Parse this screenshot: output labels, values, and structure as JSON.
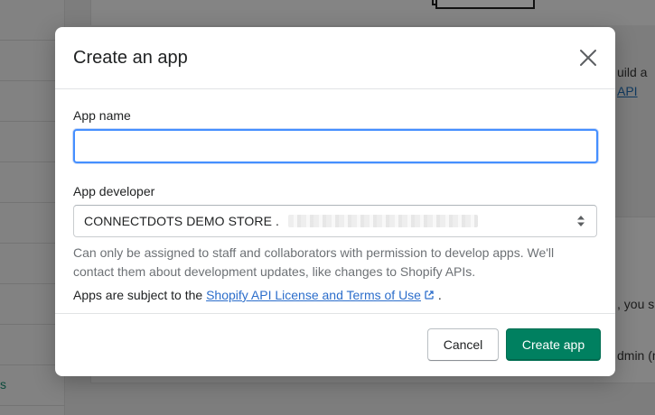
{
  "background": {
    "sidebar_text": "s",
    "text_build": "uild a",
    "link_api": "API",
    "text_you": ", you sh",
    "text_admin": "dmin (m"
  },
  "modal": {
    "title": "Create an app",
    "close_icon": "close-icon",
    "app_name": {
      "label": "App name",
      "value": "",
      "placeholder": ""
    },
    "app_developer": {
      "label": "App developer",
      "selected": "CONNECTDOTS DEMO STORE ."
    },
    "help_text": "Can only be assigned to staff and collaborators with permission to develop apps. We'll contact them about development updates, like changes to Shopify APIs.",
    "terms": {
      "prefix": "Apps are subject to the",
      "link": "Shopify API License and Terms of Use",
      "suffix": "."
    },
    "buttons": {
      "cancel": "Cancel",
      "create": "Create app"
    }
  },
  "colors": {
    "primary": "#008060",
    "link": "#2c6ecb",
    "focus": "#458fff",
    "overlay": "#7f7f7f"
  }
}
